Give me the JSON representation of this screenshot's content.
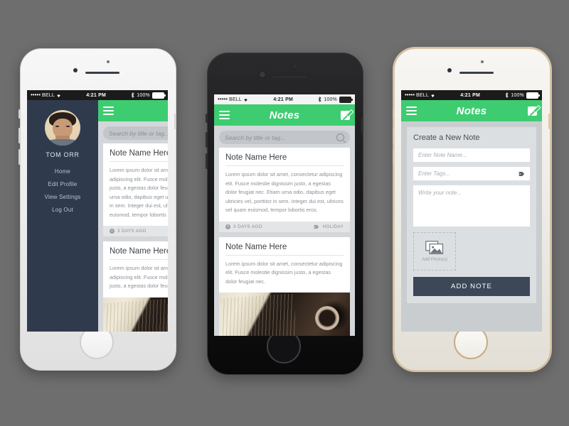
{
  "canvas": {
    "background": "#6e6e6e"
  },
  "theme": {
    "green": "#3ecc71",
    "navy": "#2f3b4d",
    "button_navy": "#3c4858",
    "screen_bg": "#d4d7da"
  },
  "statusbar": {
    "carrier": "BELL",
    "dots": "•••••",
    "time": "4:21 PM",
    "battery": "100%",
    "bluetooth_icon": "bluetooth-icon",
    "wifi_icon": "wifi-icon"
  },
  "phones": [
    {
      "id": "phone-left",
      "frame": "white",
      "statusbar_style": "dark",
      "screen": "notes-list-drawer-open"
    },
    {
      "id": "phone-center",
      "frame": "black",
      "statusbar_style": "light",
      "screen": "notes-list"
    },
    {
      "id": "phone-right",
      "frame": "gold",
      "statusbar_style": "dark",
      "screen": "create-note"
    }
  ],
  "navbar": {
    "title": "Notes",
    "title_partial": "No",
    "menu_icon": "hamburger-icon",
    "compose_icon": "compose-icon"
  },
  "drawer": {
    "user_name": "TOM ORR",
    "avatar_icon": "user-avatar",
    "items": [
      {
        "label": "Home"
      },
      {
        "label": "Edit Profile"
      },
      {
        "label": "View Settings"
      },
      {
        "label": "Log Out"
      }
    ]
  },
  "search": {
    "placeholder": "Search by title or tag...",
    "icon": "search-icon"
  },
  "notes": [
    {
      "title": "Note Name Here",
      "body": "Lorem ipsum dolor sit amet, consectetur adipiscing elit. Fusce molestie dignissim justo, a egestas dolor feugiat nec. Etiam urna odio, dapibus eget ultricies vel, porttitor in sem. Integer dui est, ultrices vel quam euismod, tempor lobortis eros.",
      "date": "3 DAYS AGO",
      "tag": "HOLIDAY",
      "date_icon": "clock-icon",
      "tag_icon": "tag-icon",
      "has_photo": false
    },
    {
      "title": "Note Name Here",
      "body": "Lorem ipsum dolor sit amet, consectetur adipiscing elit. Fusce molestie dignissim justo, a egestas dolor feugiat nec.",
      "date": "",
      "tag": "",
      "date_icon": "clock-icon",
      "tag_icon": "tag-icon",
      "has_photo": true,
      "photo_alt": "open-notebook-with-coffee-photo"
    }
  ],
  "create_note": {
    "heading": "Create a New Note",
    "name_placeholder": "Enter Note Name...",
    "tags_placeholder": "Enter Tags...",
    "tags_icon": "tag-icon",
    "body_placeholder": "Write your note...",
    "dropzone_label": "Add Photo(s)",
    "dropzone_icon": "photo-stack-icon",
    "submit_label": "ADD NOTE"
  }
}
